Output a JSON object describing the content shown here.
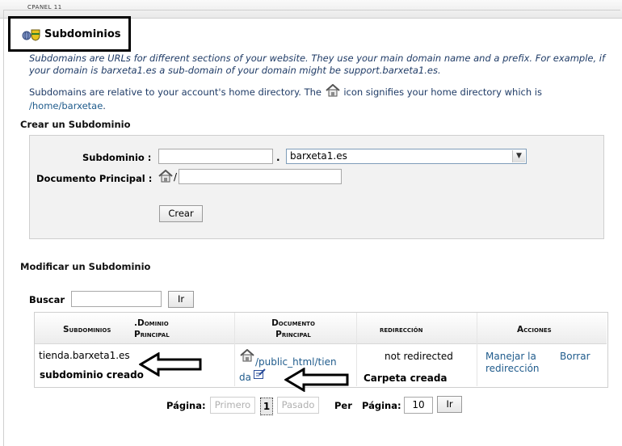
{
  "header": {
    "cpanel_label": "CPANEL 11"
  },
  "page": {
    "title": "Subdominios",
    "desc1_line1": "Subdomains are URLs for different sections of your website. They use your main domain name and a prefix. For example, if",
    "desc1_line2": "your domain is barxeta1.es a sub-domain of your domain might be support.barxeta1.es.",
    "desc2_part1": "Subdomains are relative to your account's home directory. The",
    "desc2_part2": "icon signifies your home directory which is",
    "desc2_link": "/home/barxetae",
    "desc2_end": "."
  },
  "create": {
    "section_title": "Crear un Subdominio",
    "subdomain_label": "Subdominio :",
    "subdomain_value": "",
    "dot": ".",
    "domain_selected": "barxeta1.es",
    "docroot_label": "Documento Principal :",
    "docroot_slash": "/",
    "docroot_value": "",
    "create_button": "Crear"
  },
  "modify": {
    "section_title": "Modificar un Subdominio",
    "search_label": "Buscar",
    "search_value": "",
    "search_button": "Ir",
    "columns": {
      "subdomains": "Subdominios",
      "main_domain": ".Dominio Principal",
      "docroot": "Documento Principal",
      "redirect": "redirección",
      "actions": "Acciones"
    },
    "row": {
      "subdomain": "tienda.barxeta1.es",
      "docroot_line1": "/public_html/tien",
      "docroot_line2": "da",
      "redirect": "not redirected",
      "manage_line1": "Manejar la",
      "manage_line2": "redirección",
      "delete": "Borrar"
    },
    "annotations": {
      "subdomain_created": "subdominio creado",
      "folder_created": "Carpeta creada"
    }
  },
  "pagination": {
    "page_label": "Página:",
    "first": "Primero",
    "current": "1",
    "last": "Pasado",
    "per_label": "Per",
    "page_label2": "Página:",
    "per_value": "10",
    "go_button": "Ir"
  }
}
